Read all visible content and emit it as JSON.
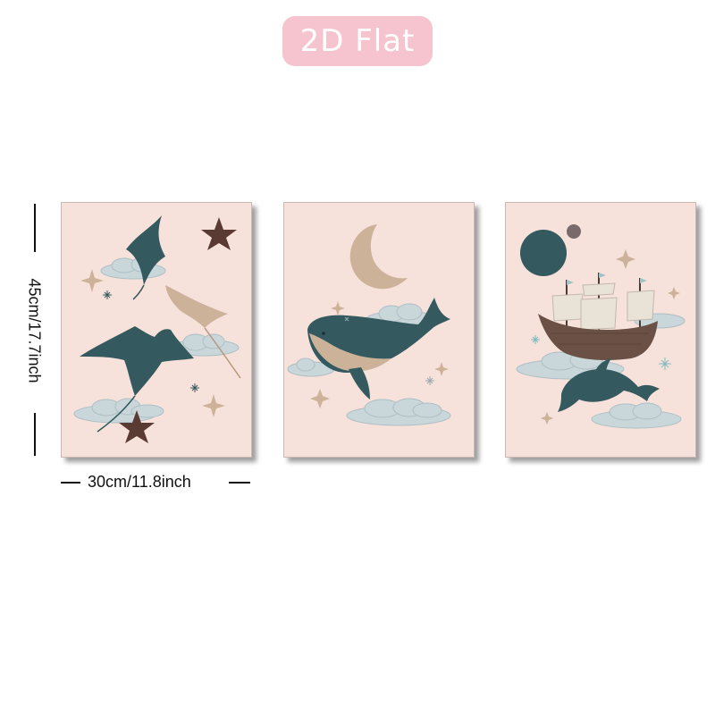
{
  "badge": {
    "label": "2D Flat"
  },
  "dimensions": {
    "height_label": "45cm/17.7inch",
    "width_label": "30cm/11.8inch"
  },
  "posters": [
    {
      "subject": "manta rays among clouds with starfish"
    },
    {
      "subject": "whale swimming under crescent moon"
    },
    {
      "subject": "sailing ship and dolphin in clouds"
    }
  ],
  "colors": {
    "badge": "#f6c4cf",
    "poster_bg": "#f6e2da",
    "teal": "#34595f",
    "sand": "#cdb29a",
    "cloud": "#c9d6da",
    "star_dark": "#5a3b33"
  }
}
